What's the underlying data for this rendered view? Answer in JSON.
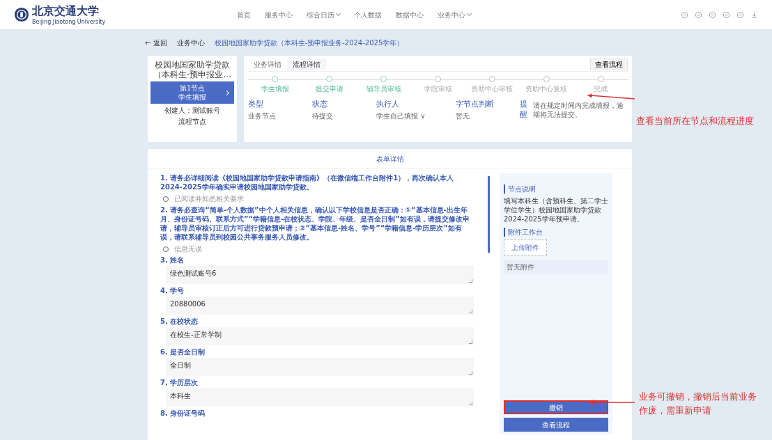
{
  "header": {
    "logo_text": "北京交通大学",
    "logo_subtext": "Beijing Jiaotong University",
    "nav": [
      {
        "label": "首页",
        "dropdown": false
      },
      {
        "label": "服务中心",
        "dropdown": false
      },
      {
        "label": "综合日历",
        "dropdown": true
      },
      {
        "label": "个人数据",
        "dropdown": false
      },
      {
        "label": "数据中心",
        "dropdown": false
      },
      {
        "label": "业务中心",
        "dropdown": true
      }
    ]
  },
  "breadcrumb": {
    "back": "← 返回",
    "items": [
      "业务中心",
      "校园地国家助学贷款（本科生-预申报业务-2024-2025学年）"
    ]
  },
  "summary_card": {
    "title": "校园地国家助学贷款（本科生-预申报业...",
    "node_button": {
      "title": "第1节点",
      "subtitle": "学生填报"
    },
    "creator": "创建人：测试账号",
    "node_label": "流程节点"
  },
  "process": {
    "tabs": [
      {
        "label": "业务详情",
        "selected": false
      },
      {
        "label": "流程详情",
        "selected": true
      }
    ],
    "view_button": "查看流程",
    "steps": [
      {
        "label": "学生填报",
        "done": true
      },
      {
        "label": "提交申请",
        "done": true
      },
      {
        "label": "辅导员审核",
        "done": true
      },
      {
        "label": "学院审核",
        "done": false
      },
      {
        "label": "资助中心审核",
        "done": false
      },
      {
        "label": "资助中心复核",
        "done": false
      },
      {
        "label": "完成",
        "done": false
      }
    ],
    "info": [
      {
        "title": "类型",
        "value": "业务节点"
      },
      {
        "title": "状态",
        "value": "待提交"
      },
      {
        "title": "执行人",
        "value": "学生自己填报 ∨"
      },
      {
        "title": "字节点判断",
        "value": "暂无"
      }
    ],
    "reminder_label": "提醒",
    "reminder_text": "请在规定时间内完成填报，逾期将无法提交。"
  },
  "form": {
    "title": "表单详情",
    "items": [
      {
        "number": "1.",
        "label": "请务必详细阅读《校园地国家助学贷款申请指南》（在微信端工作台附件1），再次确认本人2024-2025学年确实申请校园地国家助学贷款。",
        "kind": "check",
        "option": "已阅读并知悉相关要求"
      },
      {
        "number": "2.",
        "label": "请务必查询“简单-个人数据”中个人相关信息，确认以下学校信息是否正确：①“基本信息-出生年月、身份证号码、联系方式”“学籍信息-在校状态、学院、年级、是否全日制”如有误，请提交修改申请，辅导员审核订正后方可进行贷款预申请；②“基本信息-姓名、学号”“学籍信息-学历层次”如有误，请联系辅导员到校园公共事务服务人员修改。",
        "kind": "check",
        "option": "信息无误"
      },
      {
        "number": "3.",
        "label": "姓名",
        "kind": "text",
        "value": "绿色测试账号6"
      },
      {
        "number": "4.",
        "label": "学号",
        "kind": "text",
        "value": "20880006"
      },
      {
        "number": "5.",
        "label": "在校状态",
        "kind": "text",
        "value": "在校生-正常学制"
      },
      {
        "number": "6.",
        "label": "是否全日制",
        "kind": "text",
        "value": "全日制"
      },
      {
        "number": "7.",
        "label": "学历层次",
        "kind": "text",
        "value": "本科生"
      },
      {
        "number": "8.",
        "label": "身份证号码",
        "kind": "cut"
      }
    ]
  },
  "side_panel": {
    "note_title": "节点说明",
    "note_text": "填写本科生（含预科生、第二学士学位学生）校园地国家助学贷款2024-2025学年预申请。",
    "attach_title": "附件工作台",
    "upload_button": "上传附件",
    "attach_empty": "暂无附件",
    "buttons": [
      {
        "label": "撤销",
        "highlighted": true
      },
      {
        "label": "查看流程",
        "highlighted": false
      }
    ]
  },
  "annotations": [
    {
      "text": "查看当前所在节点和流程进度"
    },
    {
      "text": "业务可撤销，撤销后当前业务作废，需重新申请"
    }
  ]
}
